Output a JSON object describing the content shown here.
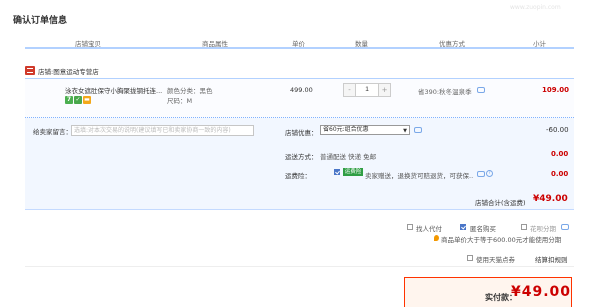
{
  "page_title": "确认订单信息",
  "columns": [
    "店铺宝贝",
    "商品属性",
    "单价",
    "数量",
    "优惠方式",
    "小计"
  ],
  "shop": {
    "prefix": "店铺:",
    "name": "图意运动专营店"
  },
  "item": {
    "title": "泳衣女遮肚保守小胸聚拢钢托连...",
    "attr_color": "颜色分类：黑色",
    "attr_size": "尺码：M",
    "price": "499.00",
    "quantity": "1",
    "minus": "-",
    "plus": "+",
    "promo": "省390:秋冬温泉季",
    "subtotal": "109.00"
  },
  "options": {
    "message_label": "给卖家留言：",
    "message_placeholder": "选填:对本次交易的说明(建议填写已和卖家协商一致的内容)",
    "shop_promo_label": "店铺优惠：",
    "shop_promo_selected": "省60元:组合优惠",
    "shop_promo_amount": "-60.00",
    "delivery_label": "运送方式：",
    "delivery_value": "普通配送 快递 免邮",
    "delivery_amount": "0.00",
    "insurance_label": "运费险：",
    "insurance_badge": "运费险",
    "insurance_text": "卖家赠送，退换货可赔退货，可获保...",
    "insurance_amount": "0.00"
  },
  "shop_total": {
    "label": "店铺合计(含运费)",
    "value": "¥49.00"
  },
  "checkout_options": {
    "friend_pay": "找人代付",
    "anonymous": "匿名购买",
    "installment": "花呗分期",
    "installment_note": "商品单价大于等于600.00元才能使用分期",
    "tmall_points": "使用天猫点券",
    "points_rule": "结算扣规则"
  },
  "pay": {
    "label": "实付款：",
    "amount": "¥49.00"
  },
  "watermark": "www.zuopin.com",
  "colors": {
    "price_red": "#cc0000",
    "border_blue": "#b2d1ff",
    "pay_border": "#ff3300"
  }
}
